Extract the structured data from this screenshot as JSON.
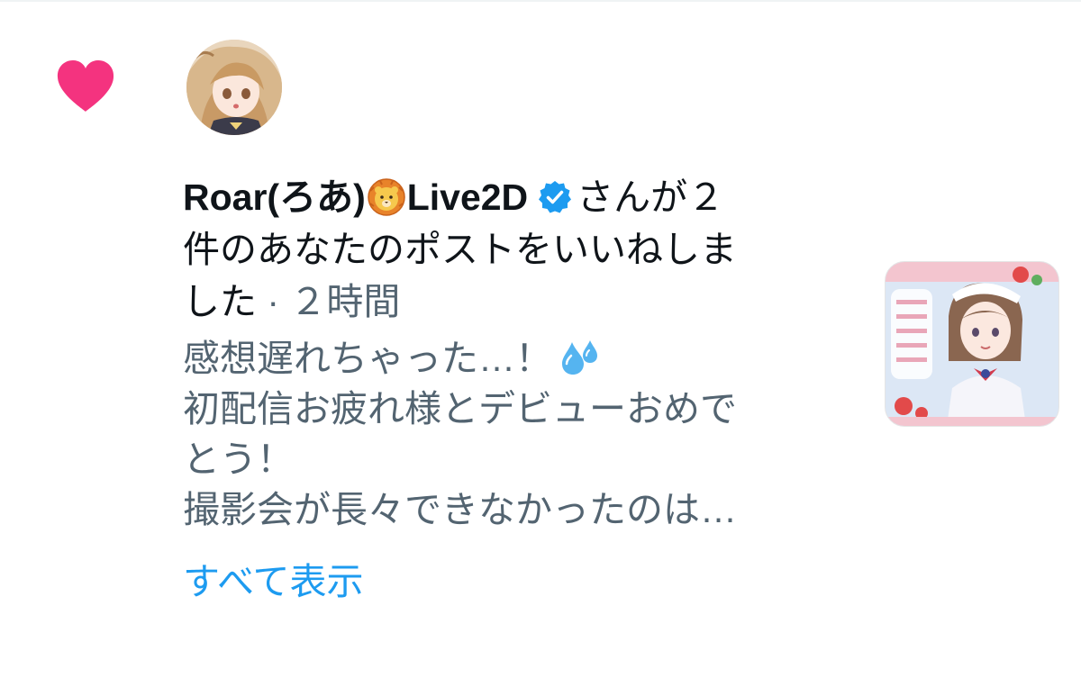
{
  "notification": {
    "type_icon": "heart-icon",
    "type_color": "#f4337f",
    "avatar_icon": "avatar",
    "user_name": "Roar(ろあ)",
    "name_emoji": "lion-face-emoji",
    "name_suffix": "Live2D",
    "verified_icon": "verified-badge-icon",
    "verified_color": "#1d9bf0",
    "action_text_1": "さんが２",
    "action_text_2": "件のあなたのポストをいいねしま",
    "action_text_3": "した",
    "separator": " · ",
    "time_ago": "２時間",
    "post_excerpt": {
      "line1": "感想遅れちゃった…！",
      "line1_emoji": "sweat-droplets-emoji",
      "line2": "初配信お疲れ様とデビューおめで",
      "line3": "とう！",
      "line4": "撮影会が長々できなかったのは…"
    },
    "show_all_label": "すべて表示",
    "show_all_color": "#1d9bf0",
    "thumbnail_icon": "post-thumbnail"
  }
}
